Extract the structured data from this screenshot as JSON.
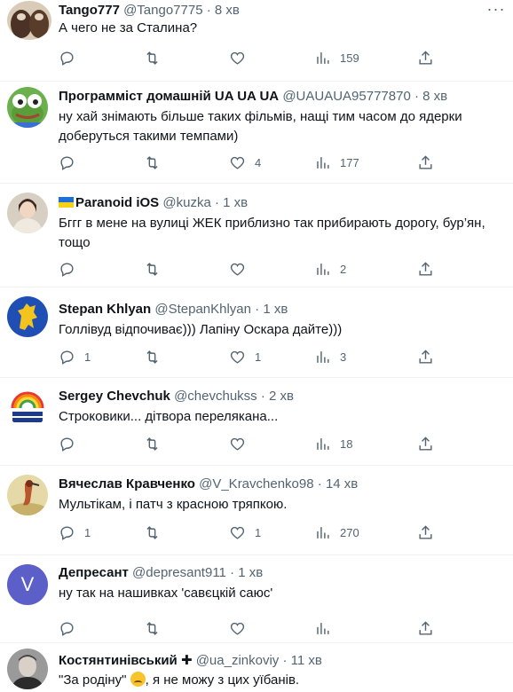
{
  "tweets": [
    {
      "name": "Tango777",
      "handle": "@Tango7775",
      "time": "8 хв",
      "text": "А чего не за Сталина?",
      "replies": "",
      "retweets": "",
      "likes": "",
      "views": "159",
      "avatar_icon": "avatar-animal-photo-icon"
    },
    {
      "name": "Программіст домашній UA UA UA",
      "handle": "@UAUAUA95777870",
      "time": "8 хв",
      "text": "ну хай знімають більше таких фільмів, нащі тим часом до ядерки доберуться такими темпами)",
      "replies": "",
      "retweets": "",
      "likes": "4",
      "views": "177",
      "avatar_icon": "avatar-frog-icon"
    },
    {
      "name": "Paranoid iOS",
      "handle": "@kuzka",
      "time": "1 хв",
      "text": "Бггг в мене на вулиці ЖЕК приблизно так прибирають дорогу, бур’ян, тощо",
      "replies": "",
      "retweets": "",
      "likes": "",
      "views": "2",
      "avatar_icon": "avatar-portrait-painting-icon",
      "flag_icon": "ukraine-flag-icon"
    },
    {
      "name": "Stepan Khlyan",
      "handle": "@StepanKhlyan",
      "time": "1 хв",
      "text": "Голлівуд відпочиває))) Лапіну Оскара дайте)))",
      "replies": "1",
      "retweets": "",
      "likes": "1",
      "views": "3",
      "avatar_icon": "avatar-lion-coat-of-arms-icon"
    },
    {
      "name": "Sergey Chevchuk",
      "handle": "@chevchukss",
      "time": "2 хв",
      "text": "Строковики... дітвора перелякана...",
      "replies": "",
      "retweets": "",
      "likes": "",
      "views": "18",
      "avatar_icon": "avatar-rainbow-logo-icon"
    },
    {
      "name": "Вячеслав Кравченко",
      "handle": "@V_Kravchenko98",
      "time": "14 хв",
      "text": "Мультікам, і патч з красною тряпкою.",
      "replies": "1",
      "retweets": "",
      "likes": "1",
      "views": "270",
      "avatar_icon": "avatar-bird-photo-icon"
    },
    {
      "name": "Депресант",
      "handle": "@depresant911",
      "time": "1 хв",
      "text": "ну так на нашивках 'савєцкій саюс'",
      "replies": "",
      "retweets": "",
      "likes": "",
      "views": "",
      "avatar_icon": "avatar-letter-icon",
      "avatar_letter": "V",
      "avatar_color": "#5b5fc7"
    },
    {
      "name": "Костянтинівський ✚",
      "handle": "@ua_zinkoviy",
      "time": "11 хв",
      "text_before": "\"За родіну\"",
      "text_after": ", я не можу з цих уїбанів.",
      "emoji_icon": "woozy-face-emoji-icon",
      "avatar_icon": "avatar-man-photo-icon"
    }
  ],
  "separator": "·"
}
